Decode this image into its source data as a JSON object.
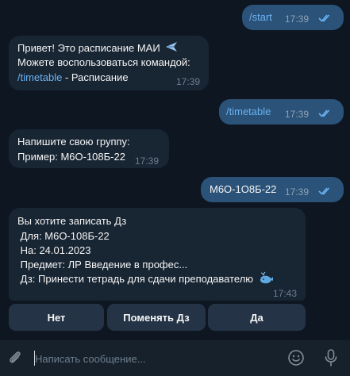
{
  "messages": [
    {
      "id": "m1",
      "direction": "out",
      "text": "/start",
      "time": "17:39",
      "status": "read"
    },
    {
      "id": "m2",
      "direction": "in",
      "lines": [
        "Привет! Это расписание МАИ",
        "Можете воспользоваться командой:"
      ],
      "emoji": "airplane",
      "command": "/timetable",
      "command_desc": " - Расписание",
      "time": "17:39"
    },
    {
      "id": "m3",
      "direction": "out",
      "text": "/timetable",
      "time": "17:39",
      "status": "read"
    },
    {
      "id": "m4",
      "direction": "in",
      "lines": [
        "Напишите свою группу:",
        "Пример: М6О-108Б-22"
      ],
      "time": "17:39"
    },
    {
      "id": "m5",
      "direction": "out",
      "text": "М6О-1О8Б-22",
      "time": "17:39",
      "status": "read"
    },
    {
      "id": "m6",
      "direction": "in",
      "lines": [
        "Вы хотите записать Дз",
        " Для: М6О-108Б-22",
        " На: 24.01.2023",
        " Предмет: ЛР Введение в профес...",
        " Дз: Принести тетрадь для сдачи преподавателю"
      ],
      "emoji": "whale",
      "time": "17:43"
    }
  ],
  "keyboard": [
    "Нет",
    "Поменять Дз",
    "Да"
  ],
  "composer": {
    "placeholder": "Написать сообщение..."
  },
  "colors": {
    "background": "#0e1621",
    "outgoing": "#2b5278",
    "incoming": "#182533",
    "link": "#6ab2f2",
    "button": "#243446"
  },
  "icons": [
    "double-check-icon",
    "airplane-emoji-icon",
    "whale-emoji-icon",
    "attach-icon",
    "emoji-icon",
    "microphone-icon"
  ]
}
